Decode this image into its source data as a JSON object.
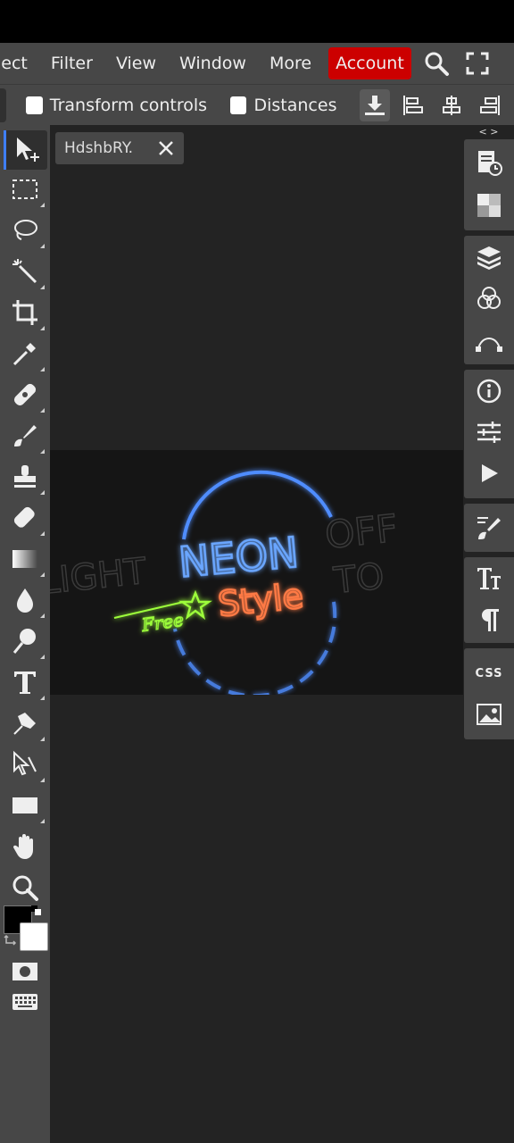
{
  "menubar": {
    "items": [
      "lect",
      "Filter",
      "View",
      "Window",
      "More"
    ],
    "account_label": "Account",
    "account_color": "#cc0000"
  },
  "options": {
    "transform_label": "Transform controls",
    "distances_label": "Distances"
  },
  "document": {
    "tab_title": "HdshbRY."
  },
  "artwork": {
    "light": "LIGHT",
    "neon": "NEON",
    "off": "OFF",
    "to": "TO",
    "style": "Style",
    "free": "Free",
    "neon_blue": "#4f8dff",
    "neon_orange": "#ff7a45",
    "neon_green": "#9dff3a"
  },
  "toolbar": {
    "active_tool": "move-tool",
    "accent": "#3f7fff"
  },
  "rightpanel": {
    "collapse_label": "< >",
    "css_label": "CSS"
  }
}
